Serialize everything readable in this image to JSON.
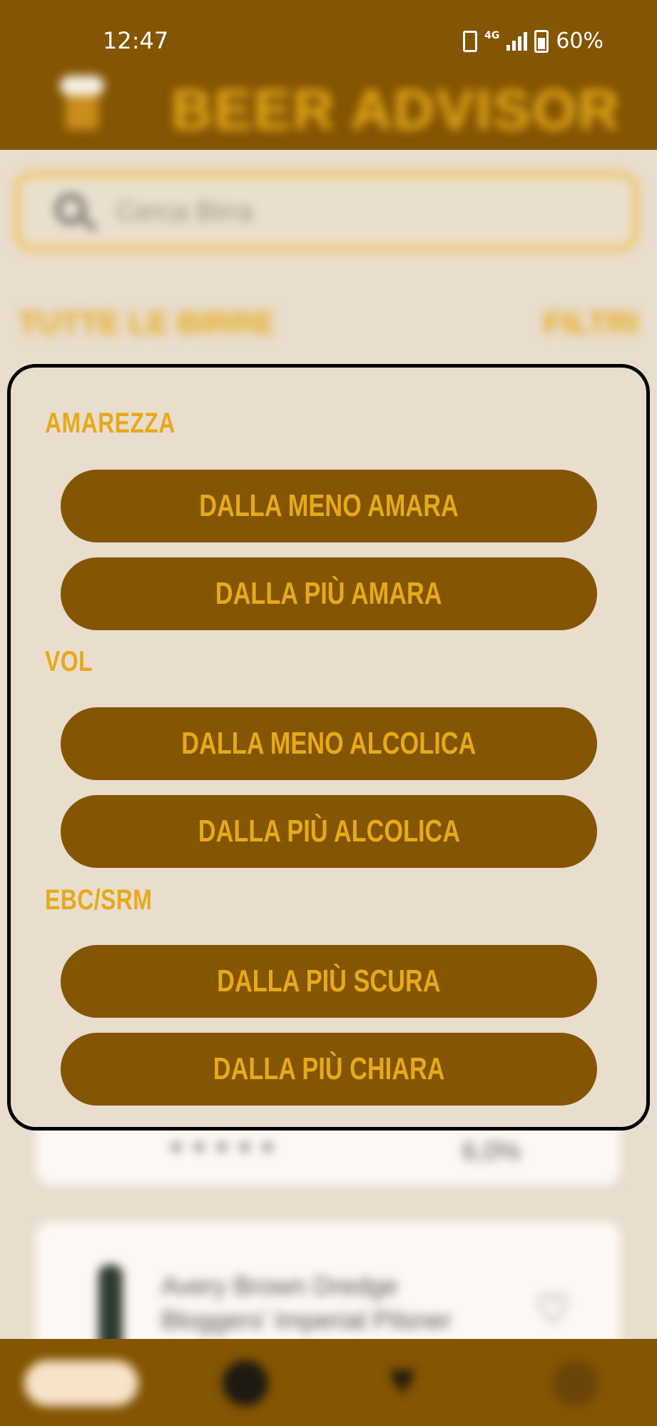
{
  "status_bar": {
    "time": "12:47",
    "network": "4G",
    "battery": "60%"
  },
  "app": {
    "title": "BEER ADVISOR"
  },
  "search": {
    "placeholder": "Cerca Birra"
  },
  "list": {
    "all_label": "TUTTE LE BIRRE",
    "filter_label": "FILTRI"
  },
  "cards": [
    {
      "value": "6,0%"
    },
    {
      "name_line1": "Avery Brown Dredge",
      "name_line2": "Bloggers' Imperial Pilsner"
    }
  ],
  "sort_dialog": {
    "sections": [
      {
        "label": "AMAREZZA",
        "options": [
          "DALLA MENO AMARA",
          "DALLA PIÙ AMARA"
        ]
      },
      {
        "label": "VOL",
        "options": [
          "DALLA MENO ALCOLICA",
          "DALLA PIÙ ALCOLICA"
        ]
      },
      {
        "label": "EBC/SRM",
        "options": [
          "DALLA PIÙ SCURA",
          "DALLA PIÙ CHIARA"
        ]
      }
    ]
  },
  "colors": {
    "brown": "#845502",
    "gold": "#e6a91a",
    "cream": "#e9ddcd"
  }
}
